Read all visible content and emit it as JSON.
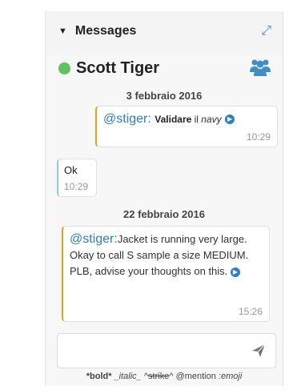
{
  "header": {
    "collapse_glyph": "▼",
    "title": "Messages",
    "expand_glyph": "⤢",
    "contact_name": "Scott Tiger"
  },
  "dates": [
    "3 febbraio 2016",
    "22 febbraio 2016"
  ],
  "messages": [
    {
      "mention": "@stiger:",
      "bold": "Validare",
      "plain": " il ",
      "italic": "navy",
      "time": "10:29"
    },
    {
      "text": "Ok",
      "time": "10:29"
    },
    {
      "mention": "@stiger:",
      "text": "Jacket is running very large. Okay to call S sample a size MEDIUM. PLB, advise your thoughts on this.",
      "time": "15:26"
    }
  ],
  "composer": {
    "hint_bold": "*bold*",
    "hint_italic": "_italic_",
    "hint_strike_open": "^",
    "hint_strike": "strike",
    "hint_strike_close": "^",
    "hint_mention": "@mention",
    "hint_emoji": ":emoji"
  },
  "colors": {
    "online": "#5ec35e",
    "accent_blue": "#2e80c0",
    "own_bubble_border": "#e7a21b",
    "other_bubble_border": "#8fcfd4"
  },
  "icons": [
    "collapse-triangle-icon",
    "expand-icon",
    "online-status-icon",
    "group-users-icon",
    "arrow-right-circle-icon",
    "send-icon"
  ]
}
